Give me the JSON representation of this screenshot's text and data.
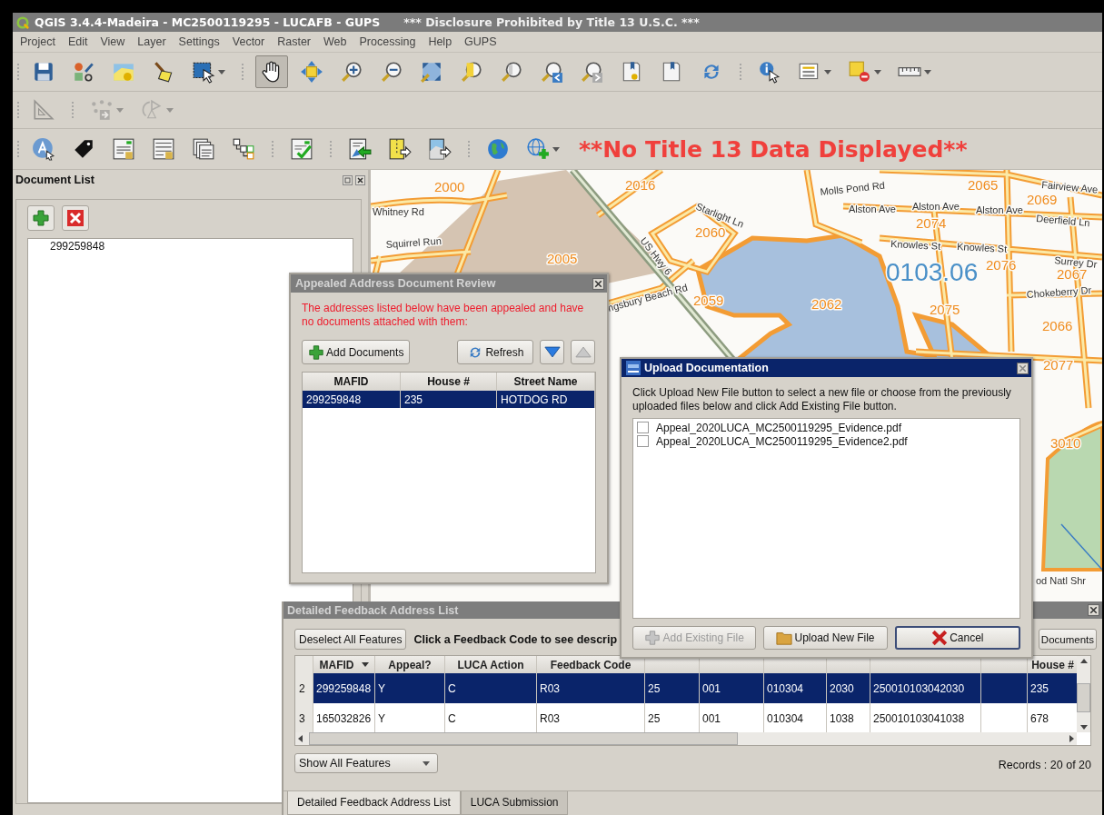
{
  "window": {
    "title": "QGIS 3.4.4-Madeira - MC2500119295 - LUCAFB - GUPS",
    "notice": "*** Disclosure Prohibited by Title 13 U.S.C. ***"
  },
  "menu": [
    "Project",
    "Edit",
    "View",
    "Layer",
    "Settings",
    "Vector",
    "Raster",
    "Web",
    "Processing",
    "Help",
    "GUPS"
  ],
  "toolbars": [
    {
      "tools": [
        {
          "kind": "save",
          "selected": false,
          "disabled": false,
          "dropdown": false
        },
        {
          "kind": "style",
          "selected": false,
          "disabled": false,
          "dropdown": false
        },
        {
          "kind": "layer",
          "selected": false,
          "disabled": false,
          "dropdown": false
        },
        {
          "kind": "brush",
          "selected": false,
          "disabled": false,
          "dropdown": false
        },
        {
          "kind": "select",
          "selected": false,
          "disabled": false,
          "dropdown": true
        },
        {
          "kind": "separator"
        },
        {
          "kind": "pan",
          "selected": true,
          "disabled": false,
          "dropdown": false
        },
        {
          "kind": "pansel",
          "selected": false,
          "disabled": false,
          "dropdown": false
        },
        {
          "kind": "zin",
          "selected": false,
          "disabled": false,
          "dropdown": false
        },
        {
          "kind": "zout",
          "selected": false,
          "disabled": false,
          "dropdown": false
        },
        {
          "kind": "zfull",
          "selected": false,
          "disabled": false,
          "dropdown": false
        },
        {
          "kind": "zsel",
          "selected": false,
          "disabled": false,
          "dropdown": false
        },
        {
          "kind": "zlayer",
          "selected": false,
          "disabled": false,
          "dropdown": false
        },
        {
          "kind": "zlast",
          "selected": false,
          "disabled": false,
          "dropdown": false
        },
        {
          "kind": "znext",
          "selected": false,
          "disabled": false,
          "dropdown": false
        },
        {
          "kind": "bmnew",
          "selected": false,
          "disabled": false,
          "dropdown": false
        },
        {
          "kind": "bm",
          "selected": false,
          "disabled": false,
          "dropdown": false
        },
        {
          "kind": "refresh",
          "selected": false,
          "disabled": false,
          "dropdown": false
        },
        {
          "kind": "separator"
        },
        {
          "kind": "identify",
          "selected": false,
          "disabled": false,
          "dropdown": false
        },
        {
          "kind": "table",
          "selected": false,
          "disabled": false,
          "dropdown": true
        },
        {
          "kind": "deselect",
          "selected": false,
          "disabled": false,
          "dropdown": true
        },
        {
          "kind": "measure",
          "selected": false,
          "disabled": false,
          "dropdown": true
        }
      ]
    },
    {
      "tools": [
        {
          "kind": "setsq",
          "selected": false,
          "disabled": true,
          "dropdown": false
        },
        {
          "kind": "separator"
        },
        {
          "kind": "nodes",
          "selected": false,
          "disabled": true,
          "dropdown": true
        },
        {
          "kind": "rotate",
          "selected": false,
          "disabled": true,
          "dropdown": true
        }
      ]
    },
    {
      "tools": [
        {
          "kind": "label",
          "selected": false,
          "disabled": false,
          "dropdown": false
        },
        {
          "kind": "tag",
          "selected": false,
          "disabled": false,
          "dropdown": false
        },
        {
          "kind": "form",
          "selected": false,
          "disabled": false,
          "dropdown": false
        },
        {
          "kind": "list",
          "selected": false,
          "disabled": false,
          "dropdown": false
        },
        {
          "kind": "docs",
          "selected": false,
          "disabled": false,
          "dropdown": false
        },
        {
          "kind": "tree",
          "selected": false,
          "disabled": false,
          "dropdown": false
        },
        {
          "kind": "separator"
        },
        {
          "kind": "check",
          "selected": false,
          "disabled": false,
          "dropdown": false
        },
        {
          "kind": "separator"
        },
        {
          "kind": "import",
          "selected": false,
          "disabled": false,
          "dropdown": false
        },
        {
          "kind": "zip",
          "selected": false,
          "disabled": false,
          "dropdown": false
        },
        {
          "kind": "mapexp",
          "selected": false,
          "disabled": false,
          "dropdown": false
        },
        {
          "kind": "separator"
        },
        {
          "kind": "globe",
          "selected": false,
          "disabled": false,
          "dropdown": false
        },
        {
          "kind": "globeadd",
          "selected": false,
          "disabled": false,
          "dropdown": true
        }
      ],
      "banner": "**No Title 13 Data Displayed**"
    }
  ],
  "document_list": {
    "title": "Document List",
    "items": [
      "299259848"
    ]
  },
  "map": {
    "labels": [
      {
        "kind": "block",
        "text": "2000"
      },
      {
        "kind": "block",
        "text": "2016"
      },
      {
        "kind": "block",
        "text": "2065"
      },
      {
        "kind": "block",
        "text": "2069"
      },
      {
        "kind": "block",
        "text": "2074"
      },
      {
        "kind": "block",
        "text": "2060"
      },
      {
        "kind": "block",
        "text": "2005"
      },
      {
        "kind": "tract",
        "text": "0103.06"
      },
      {
        "kind": "block",
        "text": "2076"
      },
      {
        "kind": "block",
        "text": "2067"
      },
      {
        "kind": "block",
        "text": "2062"
      },
      {
        "kind": "block",
        "text": "2059"
      },
      {
        "kind": "block",
        "text": "2075"
      },
      {
        "kind": "block",
        "text": "2066"
      },
      {
        "kind": "block",
        "text": "2077"
      },
      {
        "kind": "block",
        "text": "3010"
      },
      {
        "kind": "street",
        "text": "Whitney Rd"
      },
      {
        "kind": "street",
        "text": "Squirrel Run"
      },
      {
        "kind": "street",
        "text": "Molls Pond Rd"
      },
      {
        "kind": "street",
        "text": "Alston Ave"
      },
      {
        "kind": "street",
        "text": "Alston Ave"
      },
      {
        "kind": "street",
        "text": "Alston Ave"
      },
      {
        "kind": "street",
        "text": "Fairview Ave"
      },
      {
        "kind": "street",
        "text": "Deerfield Ln"
      },
      {
        "kind": "street",
        "text": "Knowles St"
      },
      {
        "kind": "street",
        "text": "Knowles St"
      },
      {
        "kind": "street",
        "text": "Surrey Dr"
      },
      {
        "kind": "street",
        "text": "Chokeberry Dr"
      },
      {
        "kind": "street",
        "text": "Starlight Ln"
      },
      {
        "kind": "street",
        "text": "US Hwy 6"
      },
      {
        "kind": "street",
        "text": "ngsbury Beach Rd"
      },
      {
        "kind": "street",
        "text": "od Natl Shr"
      }
    ]
  },
  "appeal_dialog": {
    "title": "Appealed Address Document Review",
    "active": false,
    "message": "The addresses listed below have been appealed and have no documents attached with them:",
    "buttons": [
      {
        "kind": "add",
        "label": "Add Documents",
        "disabled": false
      },
      {
        "kind": "refresh",
        "label": "Refresh",
        "disabled": false
      },
      {
        "kind": "down",
        "disabled": false
      },
      {
        "kind": "up",
        "disabled": true
      }
    ],
    "columns": [
      "MAFID",
      "House #",
      "Street Name"
    ],
    "rows": [
      {
        "cells": [
          "299259848",
          "235",
          "HOTDOG RD"
        ],
        "selected": true
      }
    ]
  },
  "upload_dialog": {
    "title": "Upload Documentation",
    "active": true,
    "instructions": "Click Upload New File button to select a new file or choose from the previously uploaded files below and click Add Existing File button.",
    "files": [
      {
        "name": "Appeal_2020LUCA_MC2500119295_Evidence.pdf",
        "checked": false
      },
      {
        "name": "Appeal_2020LUCA_MC2500119295_Evidence2.pdf",
        "checked": false
      }
    ],
    "buttons": [
      {
        "kind": "add",
        "label": "Add Existing File",
        "disabled": true,
        "focused": false
      },
      {
        "kind": "folder",
        "label": "Upload New File",
        "disabled": false,
        "focused": false
      },
      {
        "kind": "cancel",
        "label": "Cancel",
        "disabled": false,
        "focused": true
      }
    ]
  },
  "feedback_list": {
    "title": "Detailed Feedback Address List",
    "deselect_button": "Deselect All Features",
    "hint": "Click a Feedback Code to see descrip",
    "documents_button": "Documents",
    "columns": [
      {
        "label": "MAFID",
        "sorted": true
      },
      {
        "label": "Appeal?",
        "sorted": false
      },
      {
        "label": "LUCA Action",
        "sorted": false
      },
      {
        "label": "Feedback Code",
        "sorted": false
      },
      {
        "sorted": false
      },
      {
        "sorted": false
      },
      {
        "sorted": false
      },
      {
        "sorted": false
      },
      {
        "sorted": false
      },
      {
        "sorted": false
      },
      {
        "label": "House #",
        "sorted": false
      }
    ],
    "rows": [
      {
        "number": "2",
        "cells": [
          "299259848",
          "Y",
          "C",
          "R03",
          "25",
          "001",
          "010304",
          "2030",
          "250010103042030",
          "",
          "235"
        ],
        "selected": true
      },
      {
        "number": "3",
        "cells": [
          "165032826",
          "Y",
          "C",
          "R03",
          "25",
          "001",
          "010304",
          "1038",
          "250010103041038",
          "",
          "678"
        ],
        "selected": false
      }
    ],
    "filter": "Show All Features",
    "records": "Records : 20 of 20",
    "tabs": [
      {
        "label": "Detailed Feedback Address List",
        "selected": true
      },
      {
        "label": "LUCA Submission",
        "selected": false
      }
    ]
  }
}
